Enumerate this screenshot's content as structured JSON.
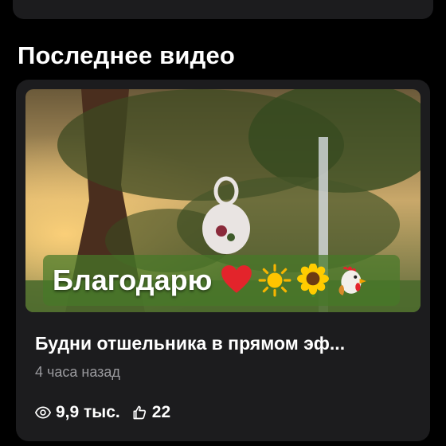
{
  "section": {
    "title": "Последнее видео"
  },
  "video": {
    "overlay_text": "Благодарю",
    "title": "Будни отшельника  в прямом эф...",
    "time_ago": "4 часа назад",
    "views": "9,9 тыс.",
    "likes": "22",
    "overlay_emojis": [
      "heart-icon",
      "sun-icon",
      "sunflower-icon",
      "rooster-icon"
    ]
  },
  "colors": {
    "background": "#000000",
    "card": "#1c1c1e",
    "secondary_text": "#9a9a9e",
    "banner": "#467828"
  }
}
